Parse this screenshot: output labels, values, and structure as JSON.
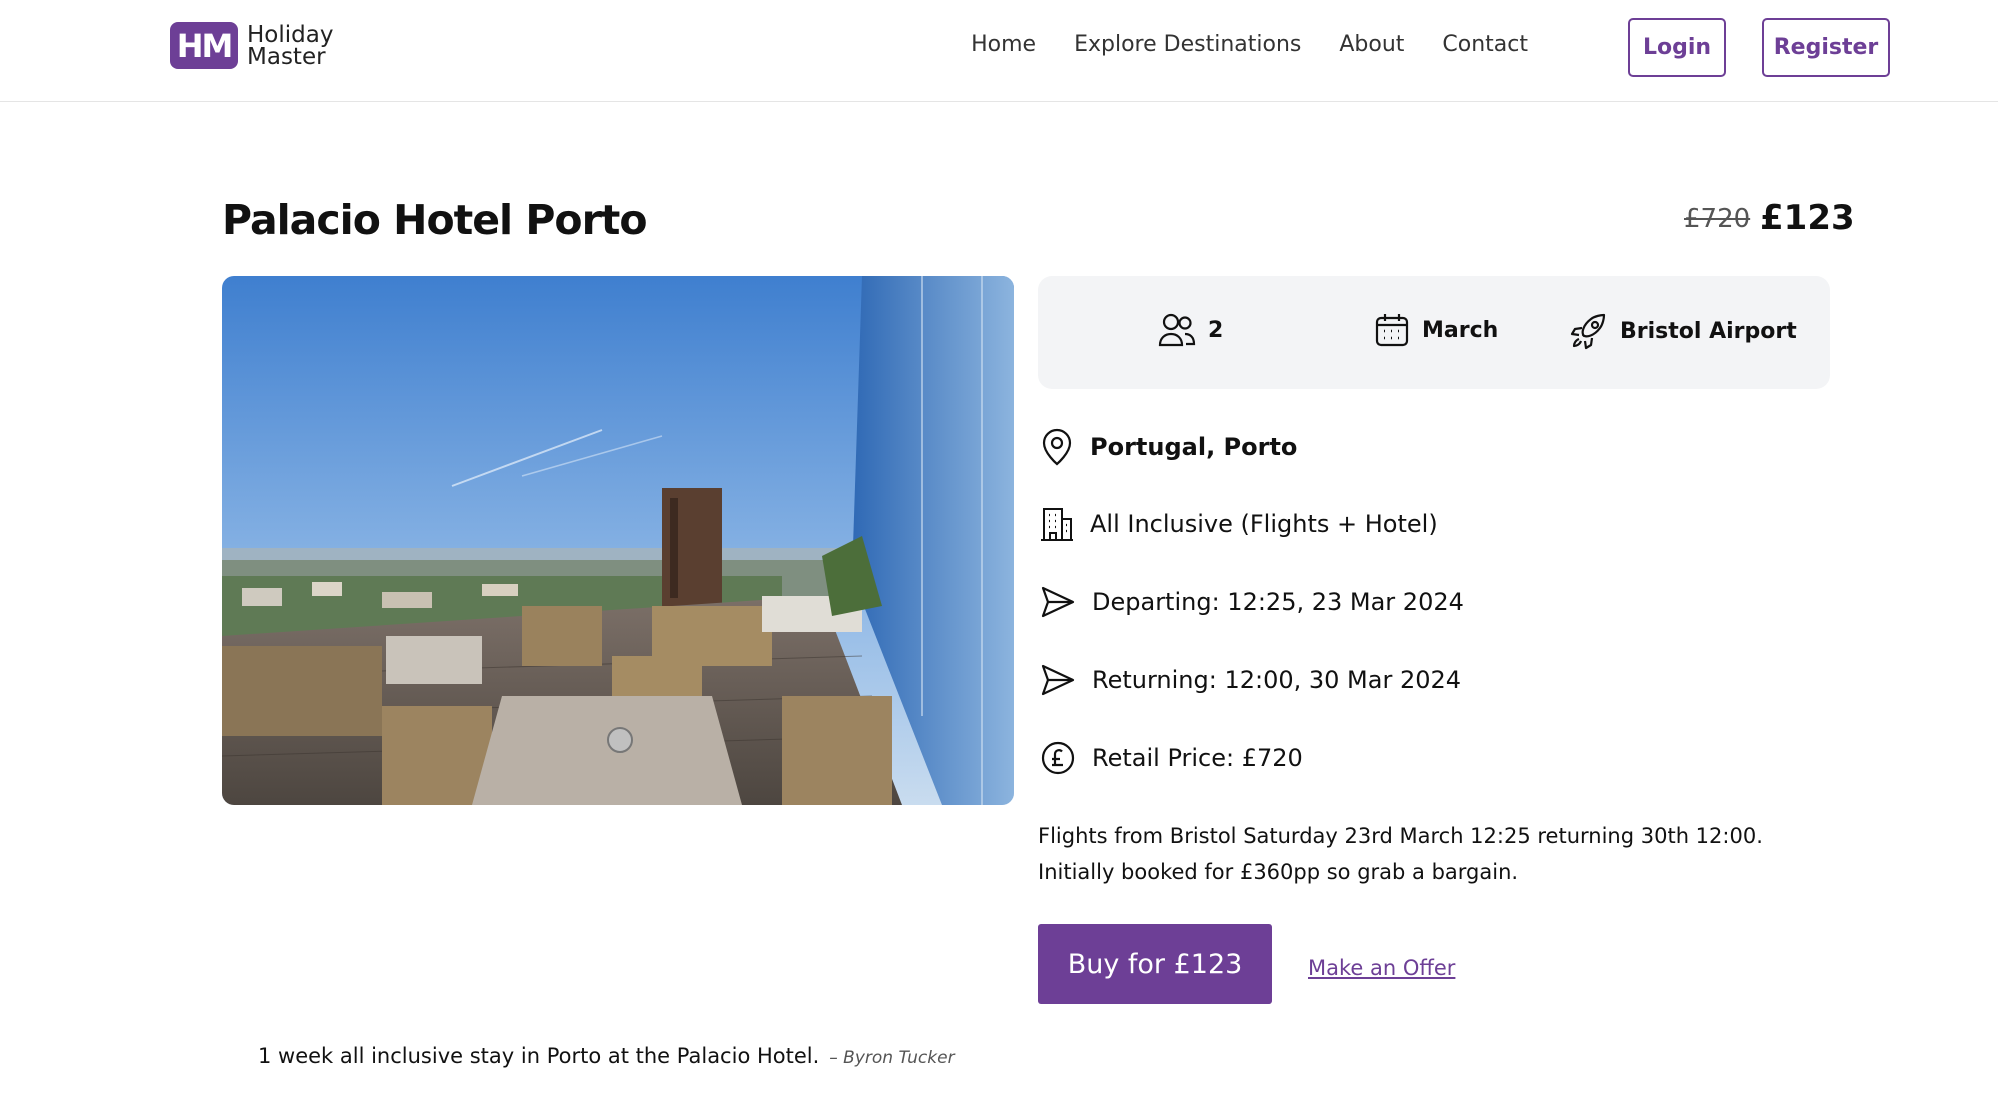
{
  "header": {
    "logo_mark": "HM",
    "logo_line1": "Holiday",
    "logo_line2": "Master",
    "nav": [
      "Home",
      "Explore Destinations",
      "About",
      "Contact"
    ],
    "login_label": "Login",
    "register_label": "Register"
  },
  "listing": {
    "title": "Palacio Hotel Porto",
    "price_old": "£720",
    "price_new": "£123"
  },
  "summary": {
    "guests": "2",
    "month": "March",
    "airport": "Bristol Airport"
  },
  "details": {
    "location": "Portugal, Porto",
    "package": "All Inclusive (Flights + Hotel)",
    "departing": "Departing: 12:25, 23 Mar 2024",
    "returning": "Returning: 12:00, 30 Mar 2024",
    "retail": "Retail Price: £720"
  },
  "description_line1": "Flights from Bristol Saturday 23rd March 12:25 returning 30th 12:00.",
  "description_line2": "Initially booked for £360pp so grab a bargain.",
  "actions": {
    "buy_label": "Buy for £123",
    "offer_label": "Make an Offer"
  },
  "caption": {
    "quote": "1 week all inclusive stay in Porto at the Palacio Hotel.",
    "author": "– Byron Tucker"
  },
  "colors": {
    "brand": "#6d3f96",
    "panel": "#f3f4f6"
  }
}
